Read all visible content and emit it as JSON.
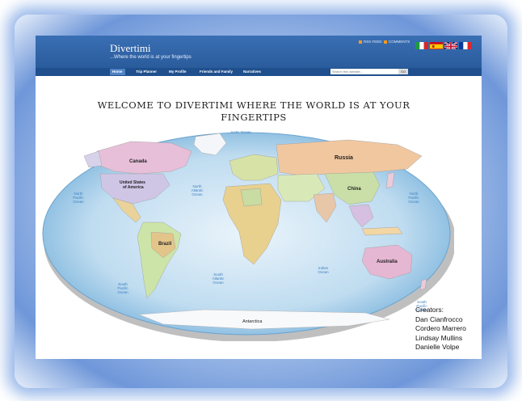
{
  "header": {
    "title": "Divertimi",
    "tagline": "...Where the world is at your fingertips",
    "rss_feed": "RSS FEED",
    "comments_feed": "COMMENTS"
  },
  "flags": [
    "italy-flag",
    "spain-flag",
    "uk-flag",
    "france-flag"
  ],
  "nav": {
    "items": [
      "Home",
      "Trip Planner",
      "My Profile",
      "Friends and Family",
      "Narratives"
    ],
    "search_placeholder": "Search this website...",
    "search_button": "GO"
  },
  "welcome": "Welcome to Divertimi where the world is at your fingertips",
  "map": {
    "countries": {
      "canada": "Canada",
      "usa_line1": "United States",
      "usa_line2": "of America",
      "brazil": "Brazil",
      "russia": "Russia",
      "china": "China",
      "australia": "Australia",
      "antarctica": "Antarctica"
    },
    "oceans": {
      "north_pacific_w_1": "North",
      "north_pacific_w_2": "Pacific",
      "north_pacific_w_3": "Ocean",
      "north_atlantic_1": "North",
      "north_atlantic_2": "Atlantic",
      "north_atlantic_3": "Ocean",
      "north_pacific_e_1": "North",
      "north_pacific_e_2": "Pacific",
      "north_pacific_e_3": "Ocean",
      "south_pacific_w_1": "South",
      "south_pacific_w_2": "Pacific",
      "south_pacific_w_3": "Ocean",
      "south_atlantic_1": "South",
      "south_atlantic_2": "Atlantic",
      "south_atlantic_3": "Ocean",
      "indian_1": "Indian",
      "indian_2": "Ocean",
      "south_pacific_e_1": "South",
      "south_pacific_e_2": "Pacific",
      "south_pacific_e_3": "Ocean",
      "arctic": "Arctic Ocean"
    }
  },
  "creators": {
    "heading": "Creators:",
    "names": [
      "Dan Cianfrocco",
      "Cordero Marrero",
      "Lindsay Mullins",
      "Danielle Volpe"
    ]
  }
}
